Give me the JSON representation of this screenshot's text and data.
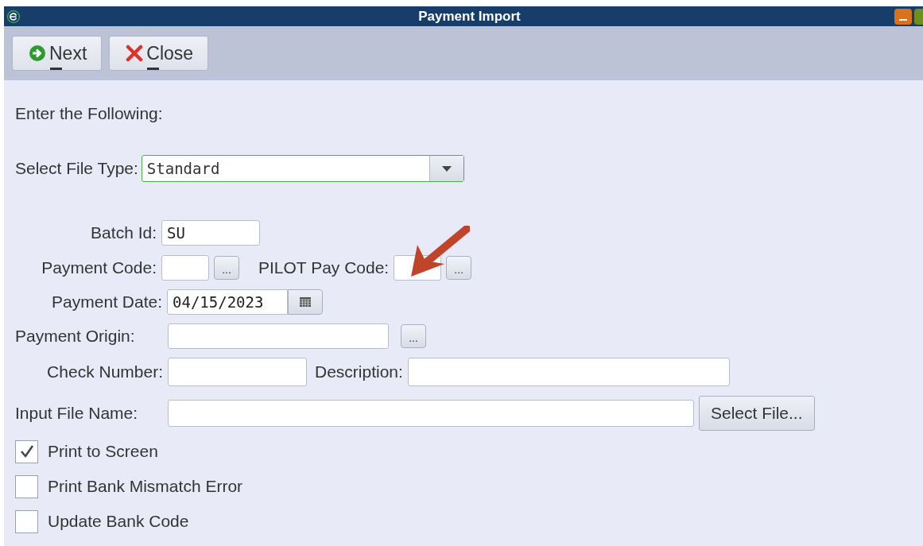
{
  "window": {
    "title": "Payment Import"
  },
  "toolbar": [
    {
      "label": "Next",
      "kind": "next"
    },
    {
      "label": "Close",
      "kind": "close"
    }
  ],
  "heading": "Enter the Following:",
  "file_type": {
    "label": "Select File Type:",
    "value": "Standard"
  },
  "batch_id": {
    "label": "Batch Id:",
    "value": "SU"
  },
  "payment_code": {
    "label": "Payment Code:",
    "button": "..."
  },
  "pilot_pay_code": {
    "label": "PILOT Pay Code:",
    "button": "..."
  },
  "payment_date": {
    "label": "Payment Date:",
    "value": "04/15/2023"
  },
  "payment_origin": {
    "label": "Payment Origin:",
    "button": "..."
  },
  "check_number": {
    "label": "Check Number:"
  },
  "description": {
    "label": "Description:"
  },
  "input_file_name": {
    "label": "Input File Name:",
    "button": "Select File..."
  },
  "options": [
    {
      "label": "Print to Screen",
      "checked": true
    },
    {
      "label": "Print Bank Mismatch Error",
      "checked": false
    },
    {
      "label": "Update Bank Code",
      "checked": false
    }
  ]
}
